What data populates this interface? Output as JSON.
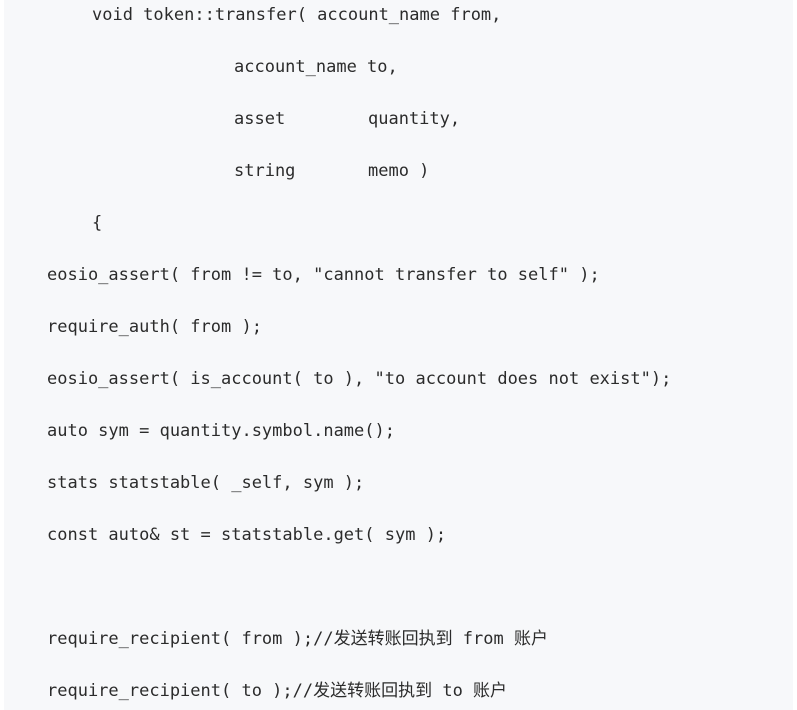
{
  "code": {
    "lines": [
      "void token::transfer( account_name from,",
      "account_name to,",
      "asset",
      "quantity,",
      "string",
      "memo )",
      "{",
      "eosio_assert( from != to, \"cannot transfer to self\" );",
      "require_auth( from );",
      "eosio_assert( is_account( to ), \"to account does not exist\");",
      "auto sym = quantity.symbol.name();",
      "stats statstable( _self, sym );",
      "const auto& st = statstable.get( sym );",
      "require_recipient( from );//发送转账回执到 from 账户",
      "require_recipient( to );//发送转账回执到 to 账户"
    ]
  }
}
